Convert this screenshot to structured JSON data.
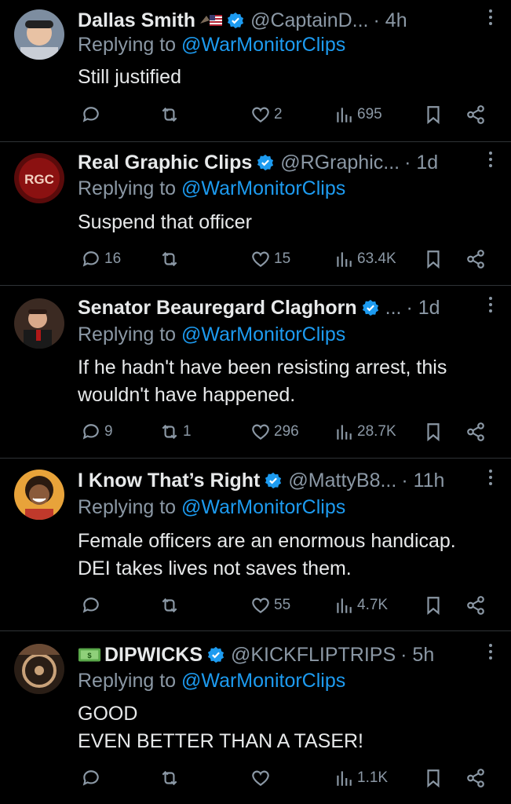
{
  "replies": [
    {
      "name": "Dallas Smith",
      "handle": "@CaptainD...",
      "time": "· 4h",
      "replying_prefix": "Replying to",
      "replying_to": "@WarMonitorClips",
      "text": "Still justified",
      "replies": "",
      "retweets": "",
      "likes": "2",
      "views": "695",
      "avatar_color": "#6d7c8c"
    },
    {
      "name": "Real Graphic Clips",
      "handle": "@RGraphic...",
      "time": "· 1d",
      "replying_prefix": "Replying to",
      "replying_to": "@WarMonitorClips",
      "text": "Suspend that officer",
      "replies": "16",
      "retweets": "",
      "likes": "15",
      "views": "63.4K",
      "avatar_color": "#8b1111",
      "avatar_text": "RGC"
    },
    {
      "name": "Senator Beauregard Claghorn",
      "handle": "...",
      "time": "· 1d",
      "replying_prefix": "Replying to",
      "replying_to": "@WarMonitorClips",
      "text": "If he hadn't have been resisting arrest, this wouldn't have happened.",
      "replies": "9",
      "retweets": "1",
      "likes": "296",
      "views": "28.7K",
      "avatar_color": "#5a3a2a"
    },
    {
      "name": "I Know That’s Right",
      "handle": "@MattyB8...",
      "time": "· 11h",
      "replying_prefix": "Replying to",
      "replying_to": "@WarMonitorClips",
      "text": "Female officers are an enormous handicap. DEI takes lives not saves them.",
      "replies": "",
      "retweets": "",
      "likes": "55",
      "views": "4.7K",
      "avatar_color": "#e8a33a"
    },
    {
      "name": "DIPWICKS",
      "handle": "@KICKFLIPTRIPS",
      "time": "· 5h",
      "replying_prefix": "Replying to",
      "replying_to": "@WarMonitorClips",
      "text_line1": "GOOD",
      "text_line2": "EVEN BETTER THAN A TASER!",
      "replies": "",
      "retweets": "",
      "likes": "",
      "views": "1.1K",
      "avatar_color": "#3a2a1e"
    }
  ],
  "colors": {
    "accent": "#1d9bf0",
    "muted": "#8b98a5",
    "text": "#e7e9ea",
    "bg": "#000000"
  }
}
